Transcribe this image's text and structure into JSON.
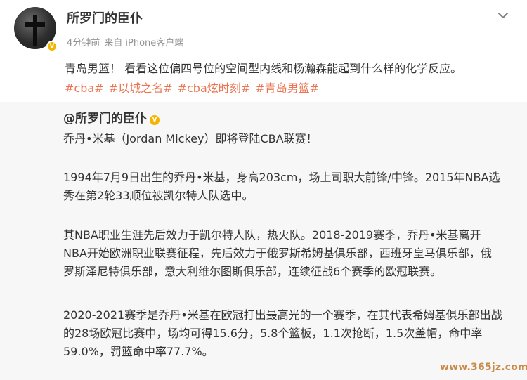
{
  "post": {
    "username": "所罗门的臣仆",
    "time": "4分钟前",
    "source": "来自 iPhone客户端",
    "text": "青岛男篮！ 看看这位偏四号位的空间型内线和杨瀚森能起到什么样的化学反应。",
    "tags": [
      "#cba#",
      "#以城之名#",
      "#cba炫时刻#",
      "#青岛男篮#"
    ]
  },
  "icons": {
    "more": "chevron-down-icon",
    "verified": "verified-badge-icon"
  },
  "repost": {
    "author": "@所罗门的臣仆",
    "lines": [
      "乔丹•米基（Jordan Mickey）即将登陆CBA联赛！",
      "1994年7月9日出生的乔丹•米基，身高203cm，场上司职大前锋/中锋。2015年NBA选",
      "秀在第2轮33顺位被凯尔特人队选中。",
      "其NBA职业生涯先后效力于凯尔特人队，热火队。2018-2019赛季，乔丹•米基离开",
      "NBA开始欧洲职业联赛征程，先后效力于俄罗斯希姆基俱乐部，西班牙皇马俱乐部，俄",
      "罗斯泽尼特俱乐部，意大利维尔图斯俱乐部，连续征战6个赛季的欧冠联赛。",
      "2020-2021赛季是乔丹•米基在欧冠打出最高光的一个赛季，在其代表希姆基俱乐部出战",
      "的28场欧冠比赛中，场均可得15.6分，5.8个篮板，1.1次抢断，1.5次盖帽，命中率",
      "59.0%，罚篮命中率77.7%。"
    ]
  },
  "watermark": "www.365jz.com",
  "colors": {
    "tag": "#eb7350",
    "verified": "#f5b400",
    "repost_bg": "#f7f7f7",
    "meta": "#939393"
  }
}
